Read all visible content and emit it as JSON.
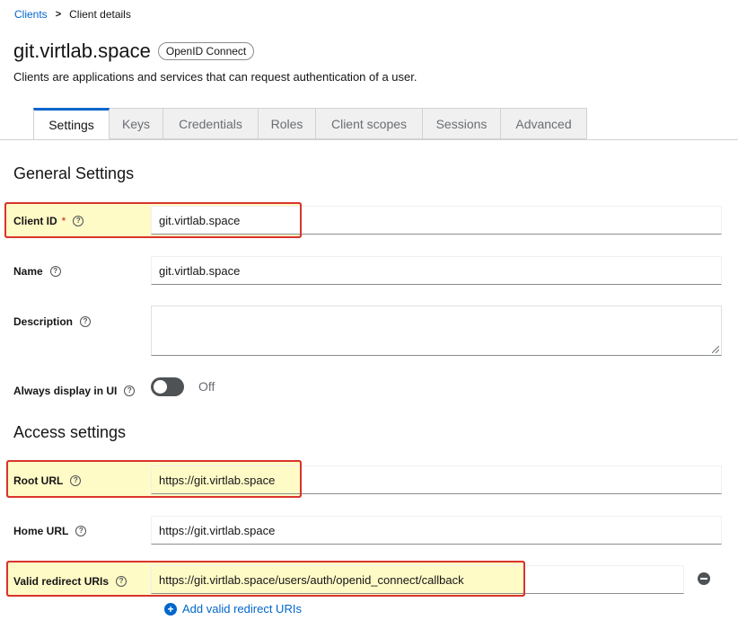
{
  "breadcrumb": {
    "clients": "Clients",
    "separator": ">",
    "current": "Client details"
  },
  "header": {
    "title": "git.virtlab.space",
    "badge": "OpenID Connect",
    "subtitle": "Clients are applications and services that can request authentication of a user."
  },
  "tabs": [
    "Settings",
    "Keys",
    "Credentials",
    "Roles",
    "Client scopes",
    "Sessions",
    "Advanced"
  ],
  "active_tab": "Settings",
  "general": {
    "heading": "General Settings",
    "client_id": {
      "label": "Client ID",
      "required": "*",
      "value": "git.virtlab.space"
    },
    "name": {
      "label": "Name",
      "value": "git.virtlab.space"
    },
    "description": {
      "label": "Description",
      "value": ""
    },
    "always_display": {
      "label": "Always display in UI",
      "state": "Off"
    }
  },
  "access": {
    "heading": "Access settings",
    "root_url": {
      "label": "Root URL",
      "value": "https://git.virtlab.space"
    },
    "home_url": {
      "label": "Home URL",
      "value": "https://git.virtlab.space"
    },
    "redirect": {
      "label": "Valid redirect URIs",
      "value": "https://git.virtlab.space/users/auth/openid_connect/callback"
    },
    "add_redirect": "Add valid redirect URIs"
  },
  "help_glyph": "?",
  "colors": {
    "link": "#0066cc",
    "highlight_border": "#d9342b",
    "highlight_fill": "#fffbc7"
  }
}
